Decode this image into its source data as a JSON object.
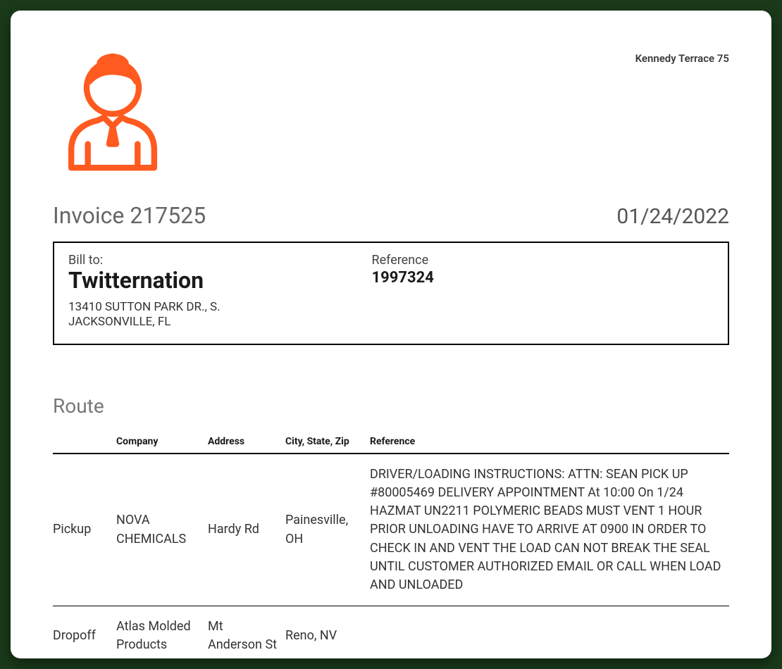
{
  "header": {
    "company_address": "Kennedy Terrace 75"
  },
  "invoice": {
    "title": "Invoice 217525",
    "date": "01/24/2022",
    "billto": {
      "label": "Bill to:",
      "company": "Twitternation",
      "address_line1": "13410 SUTTON PARK DR., S.",
      "address_line2": "JACKSONVILLE, FL"
    },
    "reference": {
      "label": "Reference",
      "value": "1997324"
    }
  },
  "route": {
    "section_title": "Route",
    "columns": {
      "type": "",
      "company": "Company",
      "address": "Address",
      "city": "City, State, Zip",
      "reference": "Reference"
    },
    "rows": [
      {
        "type": "Pickup",
        "company": "NOVA CHEMICALS",
        "address": "Hardy Rd",
        "city": "Painesville, OH",
        "reference": "DRIVER/LOADING INSTRUCTIONS: ATTN: SEAN PICK UP #80005469 DELIVERY APPOINTMENT At 10:00 On 1/24 HAZMAT UN2211 POLYMERIC BEADS MUST VENT 1 HOUR PRIOR UNLOADING HAVE TO ARRIVE AT 0900 IN ORDER TO CHECK IN AND VENT THE LOAD CAN NOT BREAK THE SEAL UNTIL CUSTOMER AUTHORIZED EMAIL OR CALL WHEN LOAD AND UNLOADED"
      },
      {
        "type": "Dropoff",
        "company": "Atlas Molded Products",
        "address": "Mt Anderson St",
        "city": "Reno, NV",
        "reference": ""
      }
    ]
  }
}
